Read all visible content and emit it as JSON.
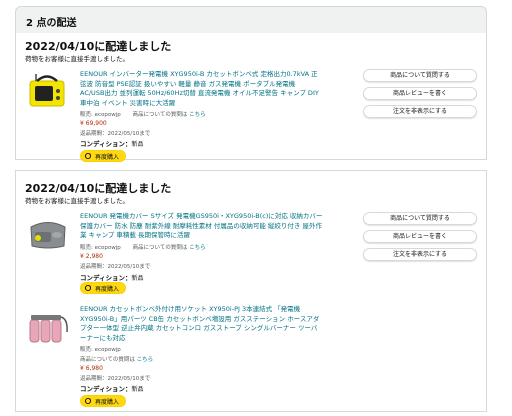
{
  "header": {
    "title": "2 点の配送"
  },
  "shipments": [
    {
      "date": "2022/04/10に配達しました",
      "note": "荷物をお客様に直接手渡しました。",
      "actions": [
        "商品について質問する",
        "商品レビューを書く",
        "注文を非表示にする"
      ],
      "items": [
        {
          "thumb_icon": "generator-image",
          "title_lines": [
            "EENOUR インバーター発電機 XYG950i-B カセットボンベ式 定格出力0.7kVA 正",
            "弦波 防音型 PSE認証 扱いやすい 軽量 静音 ガス発電機 ポータブル発電機",
            "AC/USB出力 並列運転 50Hz/60Hz切替 直流発電機 オイル不足警告 キャンプ DIY",
            "車中泊 イベント 災害時に大活躍"
          ],
          "seller_label": "販売: ecopowjp",
          "question_text": "商品についての質問は",
          "question_link": "こちら",
          "price": "¥ 69,900",
          "return_label": "返品期間：2022/05/10まで",
          "condition_label": "コンディション：",
          "condition_value": "新品",
          "rebuy_label": "再度購入"
        }
      ]
    },
    {
      "date": "2022/04/10に配達しました",
      "note": "荷物をお客様に直接手渡しました。",
      "actions": [
        "商品について質問する",
        "商品レビューを書く",
        "注文を非表示にする"
      ],
      "items": [
        {
          "thumb_icon": "generator-cover-image",
          "title_lines": [
            "EENOUR 発電機カバー Sサイズ 発電機GS950i・XYG950i-B(c)に対応 収納カバー",
            "保護カバー 防水 防塵 耐紫外線 耐摩耗性素材 付属品の収納可能 縦絞り付き 屋外作",
            "業 キャンプ 車積載 長期保管時に活躍"
          ],
          "seller_label": "販売: ecopowjp",
          "question_text": "商品についての質問は",
          "question_link": "こちら",
          "price": "¥ 2,980",
          "return_label": "返品期間：2022/05/10まで",
          "condition_label": "コンディション：",
          "condition_value": "新品",
          "rebuy_label": "再度購入"
        },
        {
          "thumb_icon": "gas-adapter-image",
          "title_lines": [
            "EENOUR カセットボンベ外付け用ソケット XY950i-PJ 3本連結式 「発電機",
            "XYG950i-B」用パーツ CB缶 カセットボンベ増設用 ガスステーション ホースアダ",
            "プター一体型 逆止弁内蔵 カセットコンロ ガスストーブ シングルバーナー ツーバ",
            "ーナーにも対応"
          ],
          "seller_label": "販売: ecopowjp",
          "question_text": "商品についての質問は",
          "question_link": "こちら",
          "price": "¥ 6,980",
          "return_label": "返品期間：2022/05/10まで",
          "condition_label": "コンディション：",
          "condition_value": "新品",
          "rebuy_label": "再度購入"
        }
      ]
    }
  ],
  "colors": {
    "link": "#007185",
    "price": "#b12704",
    "button": "#ffd814"
  }
}
